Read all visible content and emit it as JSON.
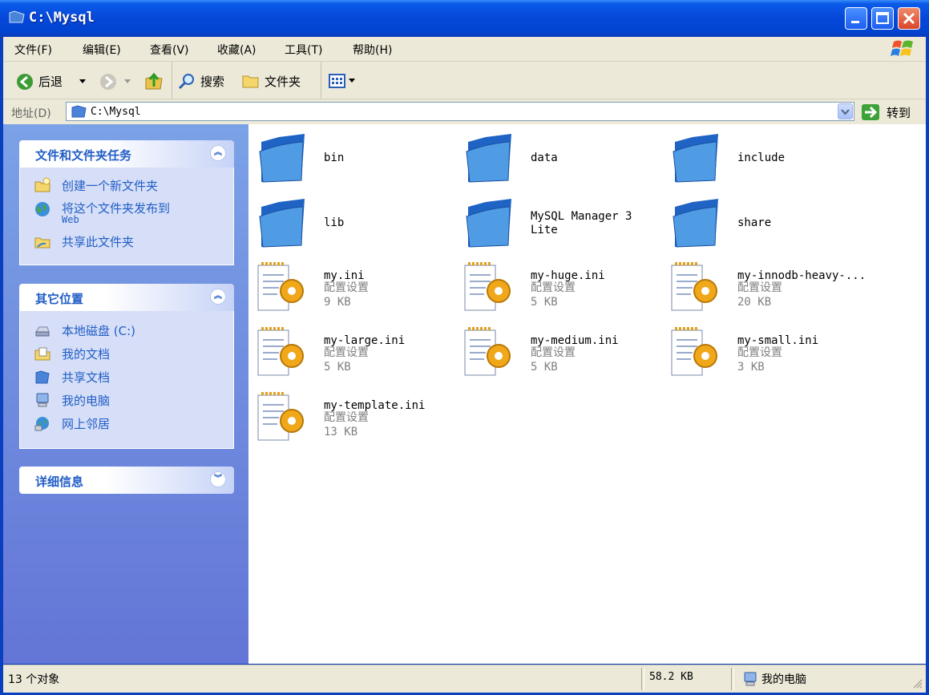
{
  "window": {
    "title": "C:\\Mysql"
  },
  "menu": [
    "文件(F)",
    "编辑(E)",
    "查看(V)",
    "收藏(A)",
    "工具(T)",
    "帮助(H)"
  ],
  "toolbar": {
    "back": "后退",
    "search": "搜索",
    "folders": "文件夹"
  },
  "address": {
    "label": "地址(D)",
    "value": "C:\\Mysql",
    "go": "转到"
  },
  "tasks_panel": {
    "title": "文件和文件夹任务",
    "items": [
      "创建一个新文件夹",
      "将这个文件夹发布到",
      "Web",
      "共享此文件夹"
    ]
  },
  "places_panel": {
    "title": "其它位置",
    "items": [
      "本地磁盘 (C:)",
      "我的文档",
      "共享文档",
      "我的电脑",
      "网上邻居"
    ]
  },
  "details_panel": {
    "title": "详细信息"
  },
  "items": [
    {
      "name": "bin",
      "type": "folder"
    },
    {
      "name": "data",
      "type": "folder"
    },
    {
      "name": "include",
      "type": "folder"
    },
    {
      "name": "lib",
      "type": "folder"
    },
    {
      "name": "MySQL Manager 3\nLite",
      "type": "folder"
    },
    {
      "name": "share",
      "type": "folder"
    },
    {
      "name": "my.ini",
      "desc": "配置设置",
      "size": "9 KB",
      "type": "ini"
    },
    {
      "name": "my-huge.ini",
      "desc": "配置设置",
      "size": "5 KB",
      "type": "ini"
    },
    {
      "name": "my-innodb-heavy-...",
      "desc": "配置设置",
      "size": "20 KB",
      "type": "ini"
    },
    {
      "name": "my-large.ini",
      "desc": "配置设置",
      "size": "5 KB",
      "type": "ini"
    },
    {
      "name": "my-medium.ini",
      "desc": "配置设置",
      "size": "5 KB",
      "type": "ini"
    },
    {
      "name": "my-small.ini",
      "desc": "配置设置",
      "size": "3 KB",
      "type": "ini"
    },
    {
      "name": "my-template.ini",
      "desc": "配置设置",
      "size": "13 KB",
      "type": "ini"
    }
  ],
  "status": {
    "count": "13 个对象",
    "size": "58.2 KB",
    "location": "我的电脑"
  },
  "colors": {
    "title_bar": "#0647d9",
    "left_pane": "#6f8fdf",
    "link": "#215dc6"
  }
}
